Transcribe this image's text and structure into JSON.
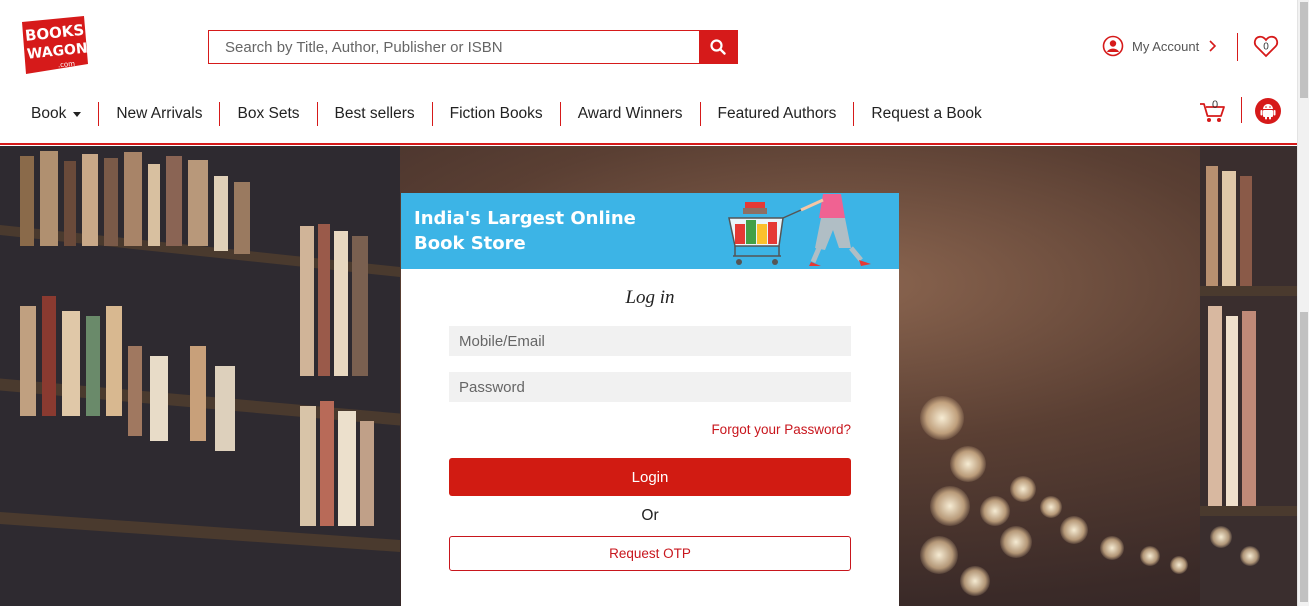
{
  "brand": {
    "logo_text_1": "BOOKS",
    "logo_text_2": "WAGON",
    "logo_text_3": ".com",
    "accent_color": "#d61a1a"
  },
  "search": {
    "placeholder": "Search by Title, Author, Publisher or ISBN",
    "icon": "search-icon"
  },
  "header": {
    "account_label": "My Account",
    "wishlist_count": "0",
    "cart_count": "0"
  },
  "nav": {
    "items": [
      {
        "label": "Book"
      },
      {
        "label": "New Arrivals"
      },
      {
        "label": "Box Sets"
      },
      {
        "label": "Best sellers"
      },
      {
        "label": "Fiction Books"
      },
      {
        "label": "Award Winners"
      },
      {
        "label": "Featured Authors"
      },
      {
        "label": "Request a Book"
      }
    ]
  },
  "login": {
    "banner_line1": "India's Largest Online",
    "banner_line2": "Book Store",
    "title": "Log in",
    "mobile_placeholder": "Mobile/Email",
    "password_placeholder": "Password",
    "forgot_label": "Forgot your Password?",
    "login_label": "Login",
    "or_label": "Or",
    "otp_label": "Request OTP"
  }
}
